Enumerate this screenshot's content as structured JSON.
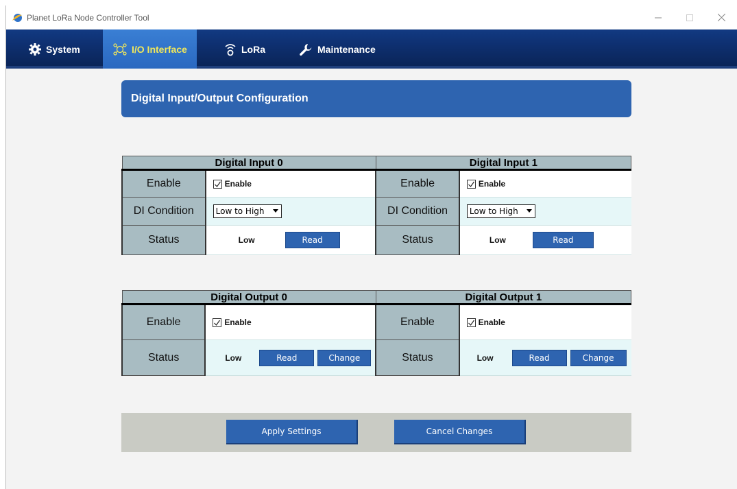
{
  "window": {
    "title": "Planet LoRa Node Controller Tool"
  },
  "nav": {
    "items": [
      {
        "label": "System",
        "icon": "gear-icon"
      },
      {
        "label": "I/O Interface",
        "icon": "io-nodes-icon",
        "active": true
      },
      {
        "label": "LoRa",
        "icon": "antenna-icon"
      },
      {
        "label": "Maintenance",
        "icon": "wrench-icon"
      }
    ]
  },
  "page": {
    "heading": "Digital Input/Output Configuration"
  },
  "labels": {
    "enable": "Enable",
    "di_condition": "DI Condition",
    "status": "Status",
    "checkbox_enable": "Enable",
    "read": "Read",
    "change": "Change"
  },
  "inputs": [
    {
      "title": "Digital Input 0",
      "enabled": true,
      "condition": "Low to High",
      "status": "Low"
    },
    {
      "title": "Digital Input 1",
      "enabled": true,
      "condition": "Low to High",
      "status": "Low"
    }
  ],
  "outputs": [
    {
      "title": "Digital Output 0",
      "enabled": true,
      "status": "Low"
    },
    {
      "title": "Digital Output 1",
      "enabled": true,
      "status": "Low"
    }
  ],
  "footer": {
    "apply": "Apply Settings",
    "cancel": "Cancel Changes"
  },
  "colors": {
    "nav_dark": "#0e2f6f",
    "nav_active": "#2a68c0",
    "active_text": "#f2e85a",
    "button_blue": "#2e64b0",
    "label_cell": "#a8bcc2",
    "value_cyan": "#e6f7f8"
  }
}
